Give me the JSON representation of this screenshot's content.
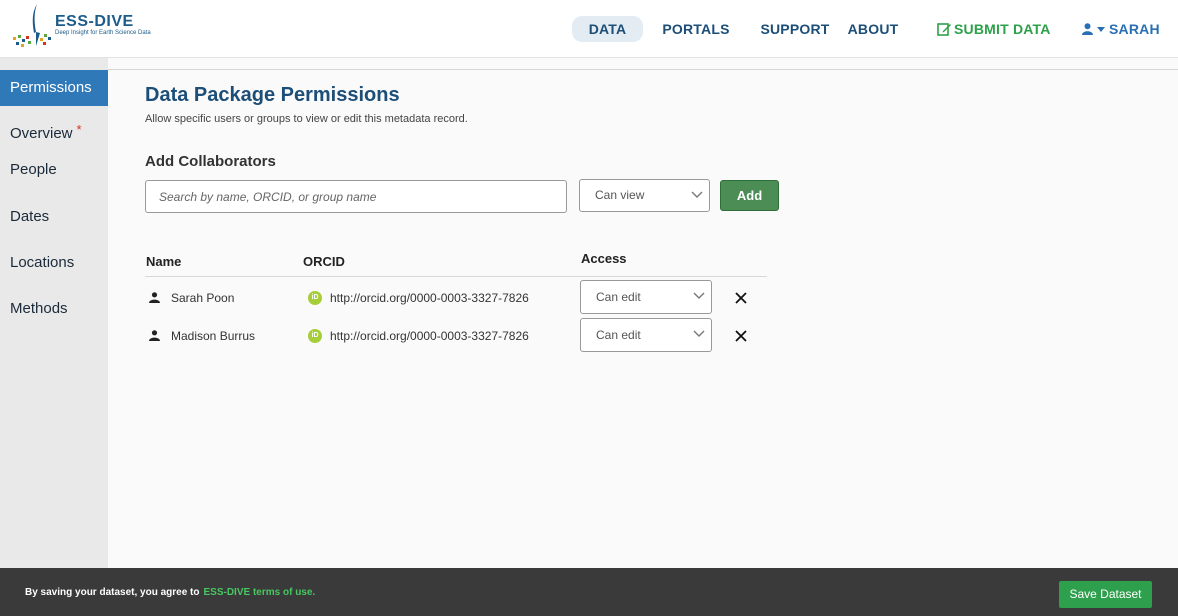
{
  "brand": {
    "name": "ESS-DIVE",
    "tagline": "Deep Insight for Earth Science Data"
  },
  "nav": {
    "data": "DATA",
    "portals": "PORTALS",
    "support": "SUPPORT",
    "about": "ABOUT",
    "submit": "SUBMIT DATA",
    "user": "SARAH"
  },
  "sidebar": {
    "items": [
      {
        "label": "Permissions",
        "active": true
      },
      {
        "label": "Overview",
        "required": "*"
      },
      {
        "label": "People"
      },
      {
        "label": "Dates"
      },
      {
        "label": "Locations"
      },
      {
        "label": "Methods"
      }
    ]
  },
  "main": {
    "title": "Data Package Permissions",
    "subtitle": "Allow specific users or groups to view or edit this metadata record.",
    "add_section_title": "Add Collaborators",
    "search_placeholder": "Search by name, ORCID, or group name",
    "access_default": "Can view",
    "add_button": "Add",
    "table": {
      "headers": {
        "name": "Name",
        "orcid": "ORCID",
        "access": "Access"
      },
      "rows": [
        {
          "name": "Sarah Poon",
          "orcid": "http://orcid.org/0000-0003-3327-7826",
          "access": "Can edit"
        },
        {
          "name": "Madison Burrus",
          "orcid": "http://orcid.org/0000-0003-3327-7826",
          "access": "Can edit"
        }
      ]
    },
    "orcid_badge": "iD"
  },
  "footer": {
    "agreement_text": "By saving your dataset, you agree to",
    "terms_link": "ESS-DIVE terms of use.",
    "save_button": "Save Dataset"
  },
  "colors": {
    "primary": "#1c4e78",
    "active_sidebar": "#2f79b9",
    "submit_green": "#2da04a",
    "add_button": "#4c8c55",
    "orcid_green": "#a6ce39",
    "footer_bg": "#3a3a3a",
    "save_button": "#2e9f4c"
  }
}
